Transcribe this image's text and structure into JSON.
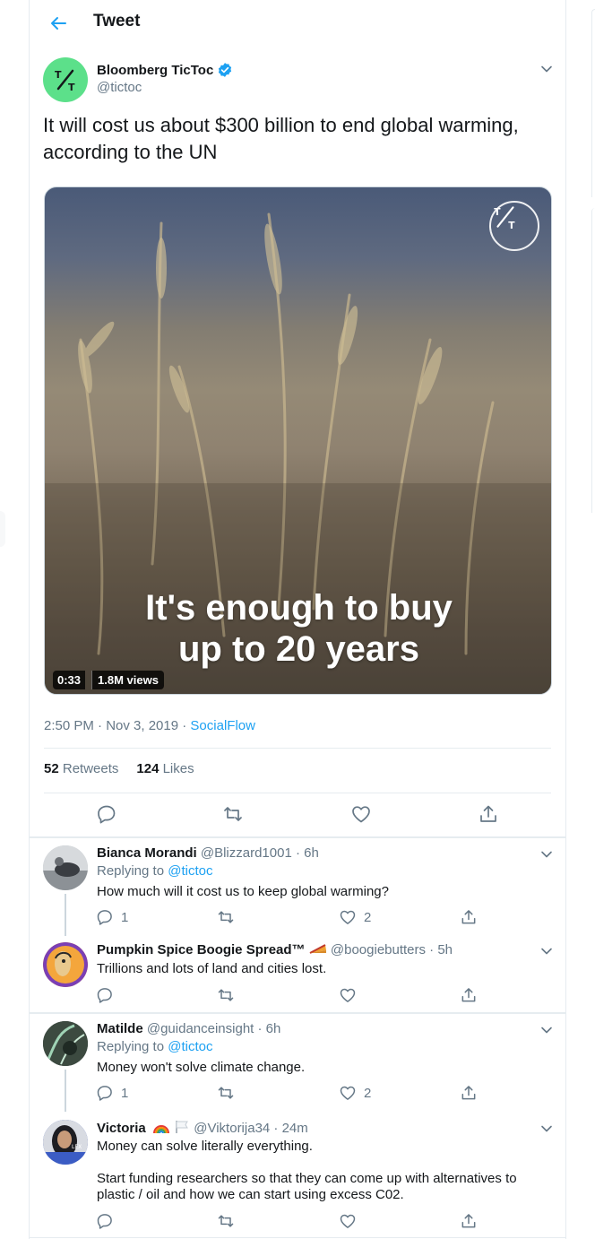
{
  "header": {
    "title": "Tweet"
  },
  "tweet": {
    "author_name": "Bloomberg TicToc",
    "author_handle": "@tictoc",
    "text": "It will cost us about $300 billion to end global warming, according to the UN",
    "video": {
      "overlay_line1": "It's enough to buy",
      "overlay_line2": "up to 20 years",
      "duration": "0:33",
      "views": "1.8M views"
    },
    "time": "2:50 PM · Nov 3, 2019 · ",
    "source": "SocialFlow",
    "retweets_count": "52",
    "retweets_label": "Retweets",
    "likes_count": "124",
    "likes_label": "Likes"
  },
  "replies": [
    {
      "name": "Bianca Morandi",
      "handle_time": " @Blizzard1001 · 6h",
      "replying_prefix": "Replying to ",
      "replying_to": "@tictoc",
      "text": "How much will it cost us to keep global warming?",
      "reply_count": "1",
      "like_count": "2"
    },
    {
      "name": "Pumpkin Spice Boogie Spread™",
      "handle_time": " @boogiebutters · 5h",
      "text": "Trillions and lots of land and cities lost."
    },
    {
      "name": "Matilde",
      "handle_time": " @guidanceinsight · 6h",
      "replying_prefix": "Replying to ",
      "replying_to": "@tictoc",
      "text": "Money won't solve climate change.",
      "reply_count": "1",
      "like_count": "2"
    },
    {
      "name": "Victoria",
      "handle_time": " @Viktorija34 · 24m",
      "text_line1": "Money can solve literally everything.",
      "text_line2": "Start funding researchers so that they can come up with alternatives to plastic / oil and how we can start using excess C02."
    }
  ],
  "colors": {
    "accent": "#1da1f2",
    "muted": "#657786",
    "border": "#e6ecf0",
    "brand_green": "#5ce08a"
  },
  "icons": [
    "back-arrow-icon",
    "verified-badge-icon",
    "chevron-down-icon",
    "reply-icon",
    "retweet-icon",
    "like-icon",
    "share-icon",
    "tictoc-logo-icon"
  ]
}
